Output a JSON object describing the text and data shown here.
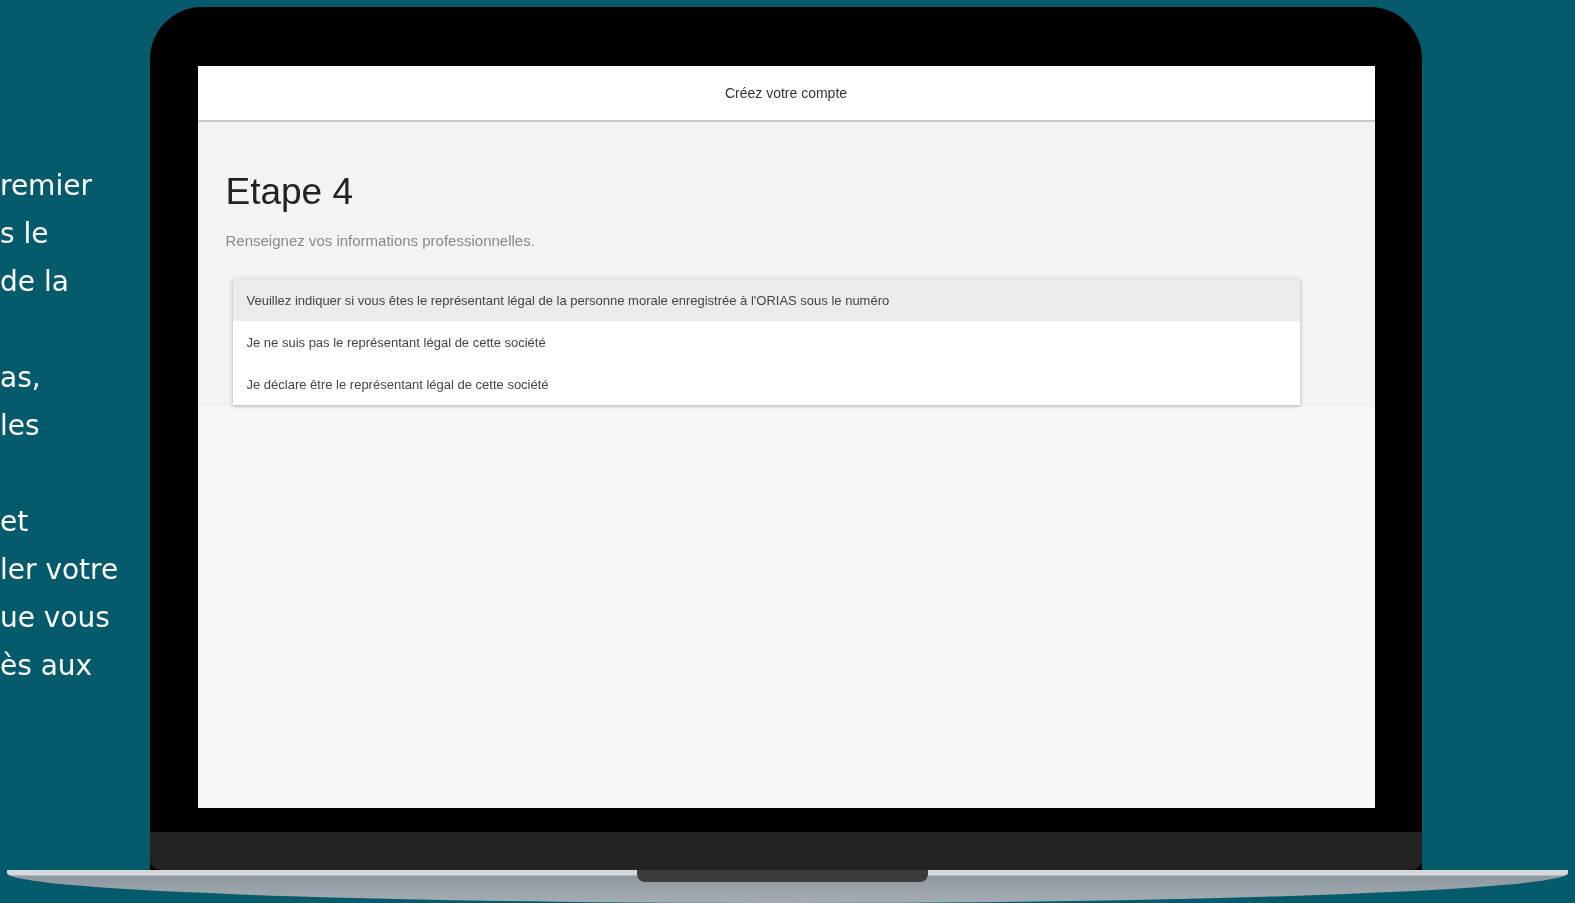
{
  "intro_text": [
    {
      "lines": [
        "remier",
        "s le",
        "de la"
      ]
    },
    {
      "lines": [
        "as,",
        "les"
      ]
    },
    {
      "lines": [
        "et",
        "ler votre",
        "ue vous",
        "ès aux"
      ]
    }
  ],
  "screen": {
    "header_title": "Créez votre compte",
    "heading": "Etape 4",
    "subtitle": "Renseignez vos informations professionnelles.",
    "question": "Veuillez indiquer si vous êtes le représentant légal de la personne morale enregistrée à l'ORIAS sous le numéro",
    "options": [
      "Je ne suis pas le représentant légal de cette société",
      "Je déclare être le représentant légal de cette société"
    ]
  }
}
